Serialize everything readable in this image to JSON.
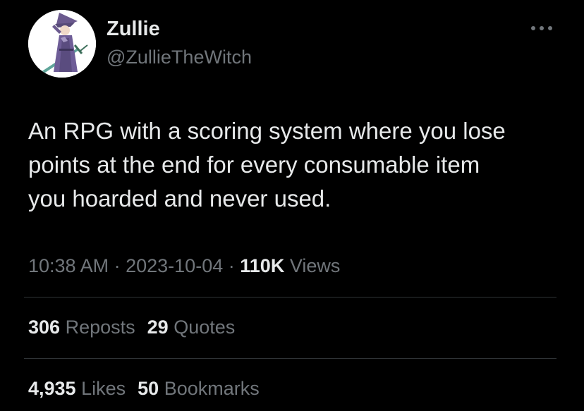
{
  "author": {
    "display_name": "Zullie",
    "handle": "@ZullieTheWitch",
    "avatar_icon": "witch-avatar-icon"
  },
  "more_icon": "more-options-icon",
  "post": {
    "text_lines": [
      "An RPG with a scoring system where you lose",
      "points at the end for every consumable item",
      "you hoarded and never used."
    ]
  },
  "meta": {
    "time": "10:38 AM",
    "separator": "·",
    "date": "2023-10-04",
    "views_count": "110K",
    "views_label": "Views"
  },
  "stats": {
    "reposts_count": "306",
    "reposts_label": "Reposts",
    "quotes_count": "29",
    "quotes_label": "Quotes",
    "likes_count": "4,935",
    "likes_label": "Likes",
    "bookmarks_count": "50",
    "bookmarks_label": "Bookmarks"
  },
  "colors": {
    "background": "#000000",
    "primary_text": "#e7e9ea",
    "secondary_text": "#71767b",
    "divider": "#2f3336"
  }
}
